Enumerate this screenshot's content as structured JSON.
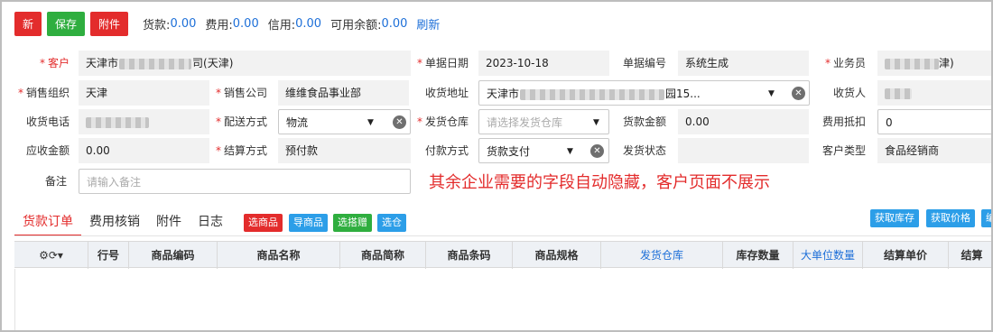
{
  "toolbar": {
    "new_label": "新",
    "save_label": "保存",
    "attach_label": "附件",
    "summary": [
      {
        "label": "货款:",
        "value": "0.00"
      },
      {
        "label": "费用:",
        "value": "0.00"
      },
      {
        "label": "信用:",
        "value": "0.00"
      },
      {
        "label": "可用余额:",
        "value": "0.00"
      }
    ],
    "refresh_label": "刷新"
  },
  "form": {
    "customer_label": "客户",
    "customer_prefix": "天津市",
    "customer_suffix": "司(天津)",
    "doc_date_label": "单据日期",
    "doc_date": "2023-10-18",
    "doc_no_label": "单据编号",
    "doc_no": "系统生成",
    "salesman_label": "业务员",
    "salesman_suffix": "津)",
    "sales_org_label": "销售组织",
    "sales_org": "天津",
    "sales_company_label": "销售公司",
    "sales_company": "维维食品事业部",
    "ship_addr_label": "收货地址",
    "ship_addr_prefix": "天津市",
    "ship_addr_suffix": "园15...",
    "receiver_label": "收货人",
    "receiver_phone_label": "收货电话",
    "delivery_method_label": "配送方式",
    "delivery_method": "物流",
    "warehouse_label": "发货仓库",
    "warehouse_placeholder": "请选择发货仓库",
    "payment_amount_label": "货款金额",
    "payment_amount": "0.00",
    "fee_offset_label": "费用抵扣",
    "fee_offset": "0",
    "receivable_label": "应收金额",
    "receivable": "0.00",
    "settle_method_label": "结算方式",
    "settle_method": "预付款",
    "pay_method_label": "付款方式",
    "pay_method": "货款支付",
    "ship_status_label": "发货状态",
    "customer_type_label": "客户类型",
    "customer_type": "食品经销商",
    "remark_label": "备注",
    "remark_placeholder": "请输入备注"
  },
  "notice": "其余企业需要的字段自动隐藏，客户页面不展示",
  "tabs": {
    "items": [
      "货款订单",
      "费用核销",
      "附件",
      "日志"
    ],
    "actions": [
      "选商品",
      "导商品",
      "选搭赠",
      "选仓"
    ],
    "right_actions": [
      "获取库存",
      "获取价格",
      "编"
    ]
  },
  "grid": {
    "columns": [
      "行号",
      "商品编码",
      "商品名称",
      "商品简称",
      "商品条码",
      "商品规格",
      "发货仓库",
      "库存数量",
      "大单位数量",
      "结算单价",
      "结算"
    ]
  },
  "colors": {
    "primary_red": "#e32c2c",
    "save_green": "#2fae3f",
    "link_blue": "#1d6fd8",
    "action_blue": "#2c9ee8"
  }
}
